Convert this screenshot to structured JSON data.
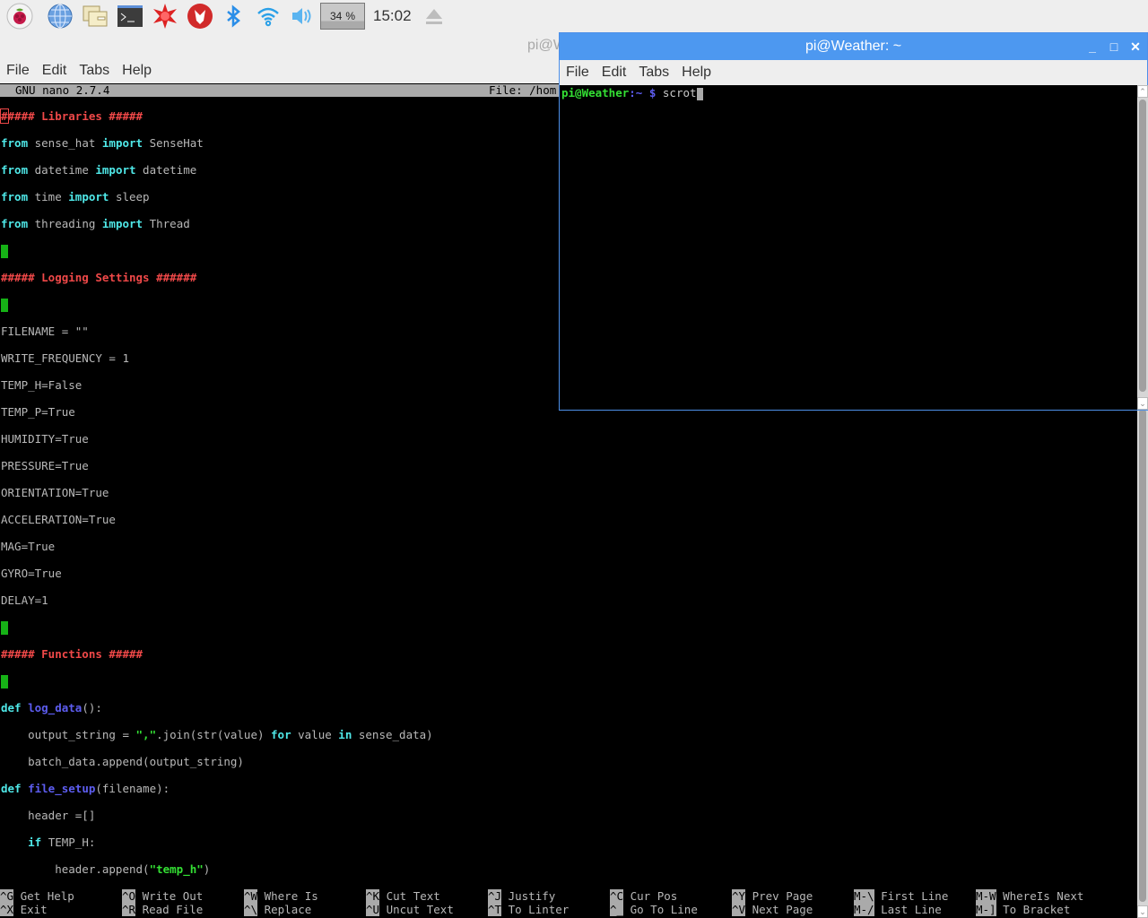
{
  "panel": {
    "launchers": [
      {
        "name": "raspberry-menu-icon"
      },
      {
        "name": "web-browser-icon"
      },
      {
        "name": "file-manager-icon"
      },
      {
        "name": "terminal-icon"
      },
      {
        "name": "mathematica-icon"
      },
      {
        "name": "wolfram-icon"
      }
    ],
    "tray": {
      "bluetooth": "bluetooth-icon",
      "wifi": "wifi-icon",
      "volume": "volume-icon",
      "cpu_value": "34",
      "cpu_unit": "%",
      "clock": "15:02",
      "eject": "eject-icon"
    }
  },
  "back_window": {
    "title": "pi@Weather: ~",
    "title_visible": "pi@W",
    "menu": [
      "File",
      "Edit",
      "Tabs",
      "Help"
    ],
    "nano": {
      "version": "GNU nano 2.7.4",
      "file_label": "File: /hom",
      "lines": [
        {
          "type": "comment",
          "text": "##### Libraries #####"
        },
        {
          "type": "import",
          "kw1": "from",
          "mod": " sense_hat ",
          "kw2": "import",
          "name": " SenseHat"
        },
        {
          "type": "import",
          "kw1": "from",
          "mod": " datetime ",
          "kw2": "import",
          "name": " datetime"
        },
        {
          "type": "import",
          "kw1": "from",
          "mod": " time ",
          "kw2": "import",
          "name": " sleep"
        },
        {
          "type": "import",
          "kw1": "from",
          "mod": " threading ",
          "kw2": "import",
          "name": " Thread"
        },
        {
          "type": "blank"
        },
        {
          "type": "comment",
          "text": "##### Logging Settings ######"
        },
        {
          "type": "blank"
        },
        {
          "type": "plain",
          "text": "FILENAME = \"\""
        },
        {
          "type": "plain",
          "text": "WRITE_FREQUENCY = 1"
        },
        {
          "type": "plain",
          "text": "TEMP_H=False"
        },
        {
          "type": "plain",
          "text": "TEMP_P=True"
        },
        {
          "type": "plain",
          "text": "HUMIDITY=True"
        },
        {
          "type": "plain",
          "text": "PRESSURE=True"
        },
        {
          "type": "plain",
          "text": "ORIENTATION=True"
        },
        {
          "type": "plain",
          "text": "ACCELERATION=True"
        },
        {
          "type": "plain",
          "text": "MAG=True"
        },
        {
          "type": "plain",
          "text": "GYRO=True"
        },
        {
          "type": "plain",
          "text": "DELAY=1"
        },
        {
          "type": "blank"
        },
        {
          "type": "comment",
          "text": "##### Functions #####"
        },
        {
          "type": "blank"
        },
        {
          "type": "def",
          "kw": "def",
          "fn": "log_data",
          "rest": "():"
        },
        {
          "type": "join",
          "a": "    output_string = ",
          "s": "\",\"",
          "b": ".join(str(value) ",
          "kw1": "for",
          "c": " value ",
          "kw2": "in",
          "d": " sense_data)"
        },
        {
          "type": "plain",
          "text": "    batch_data.append(output_string)"
        },
        {
          "type": "def",
          "kw": "def",
          "fn": "file_setup",
          "rest": "(filename):"
        },
        {
          "type": "plain",
          "text": "    header =[]"
        },
        {
          "type": "if",
          "indent": "    ",
          "kw": "if",
          "rest": " TEMP_H:"
        },
        {
          "type": "append",
          "a": "        header.append(",
          "s": "\"temp_h\"",
          "b": ")"
        }
      ],
      "shortcuts": [
        {
          "key": "^G",
          "label": "Get Help"
        },
        {
          "key": "^X",
          "label": "Exit"
        },
        {
          "key": "^O",
          "label": "Write Out"
        },
        {
          "key": "^R",
          "label": "Read File"
        },
        {
          "key": "^W",
          "label": "Where Is"
        },
        {
          "key": "^\\",
          "label": "Replace"
        },
        {
          "key": "^K",
          "label": "Cut Text"
        },
        {
          "key": "^U",
          "label": "Uncut Text"
        },
        {
          "key": "^J",
          "label": "Justify"
        },
        {
          "key": "^T",
          "label": "To Linter"
        },
        {
          "key": "^C",
          "label": "Cur Pos"
        },
        {
          "key": "^_",
          "label": "Go To Line"
        },
        {
          "key": "^Y",
          "label": "Prev Page"
        },
        {
          "key": "^V",
          "label": "Next Page"
        },
        {
          "key": "M-\\",
          "label": "First Line"
        },
        {
          "key": "M-/",
          "label": "Last Line"
        },
        {
          "key": "M-W",
          "label": "WhereIs Next"
        },
        {
          "key": "M-]",
          "label": "To Bracket"
        }
      ]
    }
  },
  "front_window": {
    "title": "pi@Weather: ~",
    "menu": [
      "File",
      "Edit",
      "Tabs",
      "Help"
    ],
    "prompt_user": "pi@Weather",
    "prompt_path": ":~ $",
    "command": " scrot",
    "buttons": {
      "minimize": "_",
      "maximize": "□",
      "close": "✕"
    }
  },
  "colors": {
    "title_active": "#4d98f0",
    "nano_comment": "#ef4848",
    "nano_keyword": "#4fe8e8",
    "nano_function": "#5d5df0",
    "nano_string": "#34e034"
  }
}
